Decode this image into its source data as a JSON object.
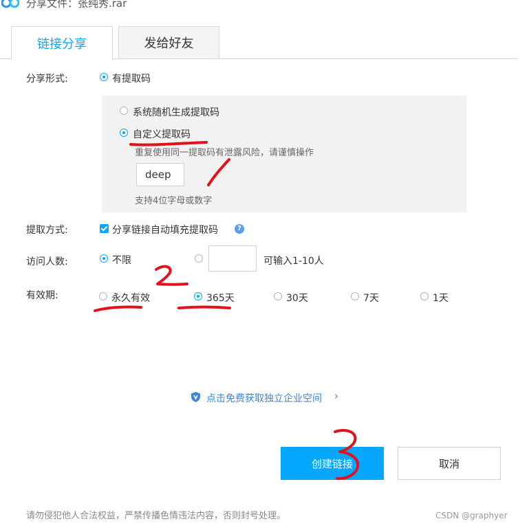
{
  "window": {
    "title": "分享文件：张纯秀.rar"
  },
  "tabs": [
    {
      "label": "链接分享",
      "active": true
    },
    {
      "label": "发给好友",
      "active": false
    }
  ],
  "share_form": {
    "label": "分享形式:",
    "option_extract_code": "有提取码",
    "sub_options": {
      "random": "系统随机生成提取码",
      "custom": "自定义提取码",
      "warning": "重复使用同一提取码有泄露风险，请谨慎操作",
      "code_value": "deep",
      "hint": "支持4位字母或数字"
    }
  },
  "extract_method": {
    "label": "提取方式:",
    "checkbox_label": "分享链接自动填充提取码",
    "checked": true
  },
  "visitors": {
    "label": "访问人数:",
    "unlimited": "不限",
    "limit_value": "",
    "limit_hint": "可输入1-10人"
  },
  "validity": {
    "label": "有效期:",
    "options": [
      "永久有效",
      "365天",
      "30天",
      "7天",
      "1天"
    ],
    "selected": "365天"
  },
  "promo": {
    "text": "点击免费获取独立企业空间"
  },
  "buttons": {
    "create": "创建链接",
    "cancel": "取消"
  },
  "footer": {
    "notice": "请勿侵犯他人合法权益，严禁传播色情违法内容，否则封号处理。"
  },
  "watermark": "CSDN @graphyer",
  "annotations": [
    "1",
    "2",
    "3"
  ],
  "colors": {
    "accent": "#06a7ff",
    "annotation": "#e0121b",
    "link": "#3a86d8"
  }
}
